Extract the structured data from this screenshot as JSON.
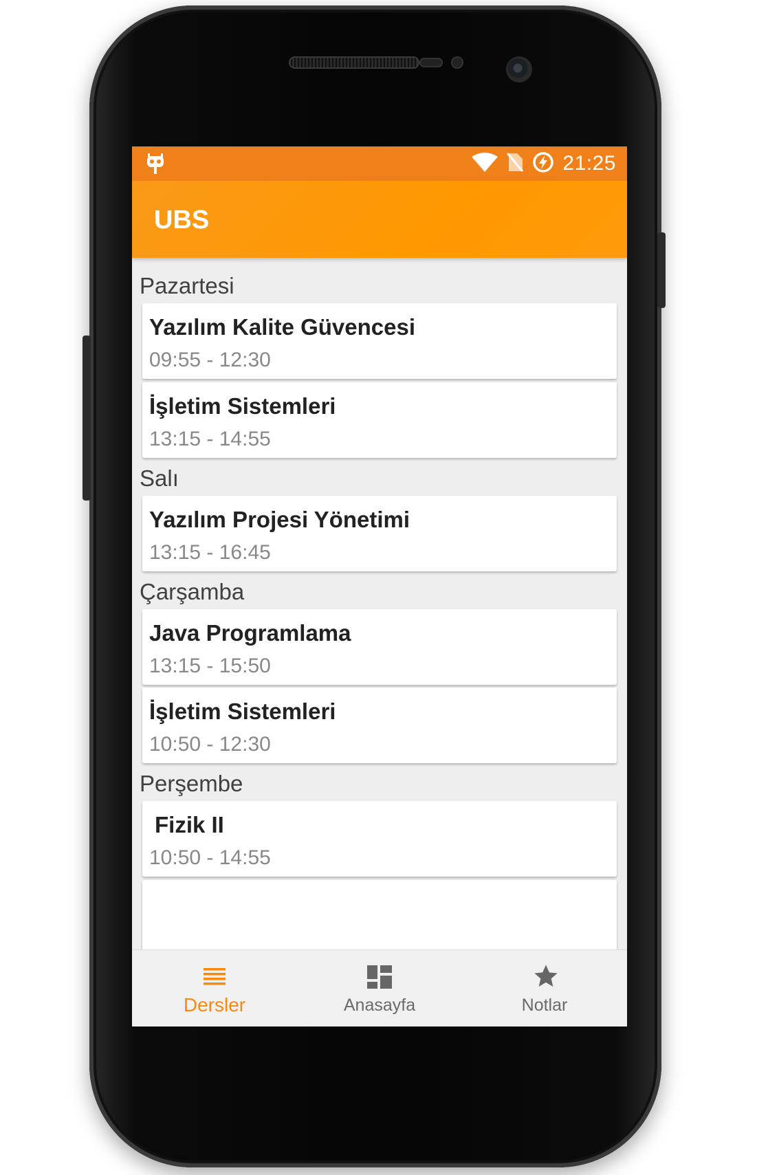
{
  "statusbar": {
    "time": "21:25"
  },
  "appbar": {
    "title": "UBS"
  },
  "schedule": [
    {
      "day": "Pazartesi",
      "courses": [
        {
          "name": "Yazılım Kalite Güvencesi",
          "time": "09:55 - 12:30"
        },
        {
          "name": "İşletim Sistemleri",
          "time": "13:15 - 14:55"
        }
      ]
    },
    {
      "day": "Salı",
      "courses": [
        {
          "name": "Yazılım Projesi Yönetimi",
          "time": "13:15 - 16:45"
        }
      ]
    },
    {
      "day": "Çarşamba",
      "courses": [
        {
          "name": "Java Programlama",
          "time": "13:15 - 15:50"
        },
        {
          "name": "İşletim Sistemleri",
          "time": "10:50 - 12:30"
        }
      ]
    },
    {
      "day": "Perşembe",
      "courses": [
        {
          "name": "Fizik II",
          "time": "10:50 - 14:55"
        }
      ]
    }
  ],
  "bottom_nav": {
    "tabs": [
      {
        "label": "Dersler",
        "icon": "list-icon",
        "active": true
      },
      {
        "label": "Anasayfa",
        "icon": "dashboard-icon",
        "active": false
      },
      {
        "label": "Notlar",
        "icon": "star-icon",
        "active": false
      }
    ]
  },
  "colors": {
    "status_bar": "#f08019",
    "app_bar": "#ff9800",
    "accent": "#f58a13",
    "background": "#eeeeee"
  }
}
